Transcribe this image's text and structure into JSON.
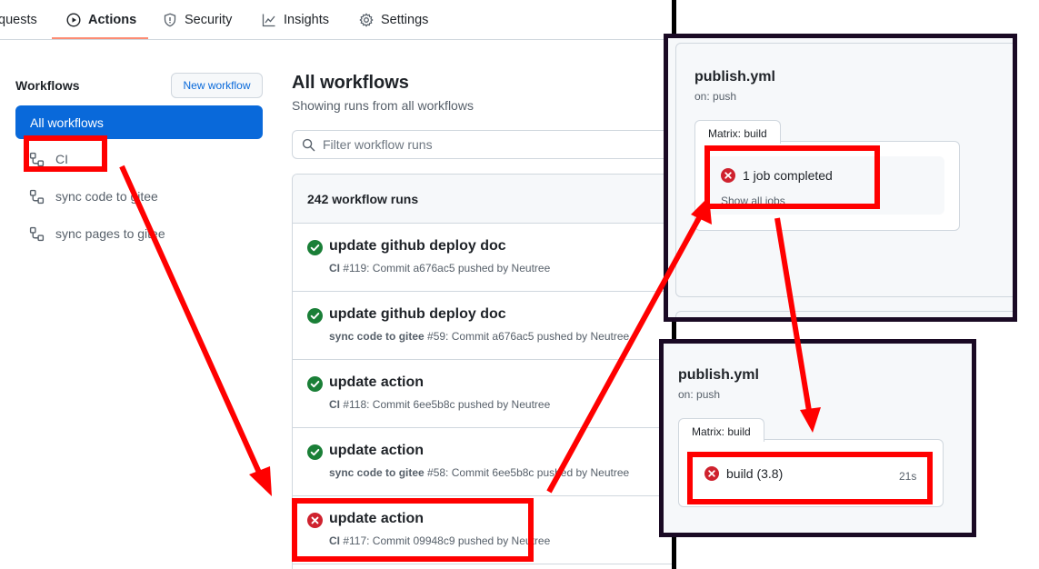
{
  "nav": {
    "tabs": [
      {
        "label": "quests",
        "icon": "pull-request-icon"
      },
      {
        "label": "Actions",
        "icon": "play-icon"
      },
      {
        "label": "Security",
        "icon": "shield-icon"
      },
      {
        "label": "Insights",
        "icon": "graph-icon"
      },
      {
        "label": "Settings",
        "icon": "gear-icon"
      }
    ],
    "active": "Actions"
  },
  "sidebar": {
    "heading": "Workflows",
    "new_workflow": "New workflow",
    "all_workflows": "All workflows",
    "items": [
      {
        "label": "CI",
        "icon": "workflow-icon"
      },
      {
        "label": "sync code to gitee",
        "icon": "workflow-icon"
      },
      {
        "label": "sync pages to gitee",
        "icon": "workflow-icon"
      }
    ]
  },
  "main": {
    "title": "All workflows",
    "subtitle": "Showing runs from all workflows",
    "filter_placeholder": "Filter workflow runs",
    "runs_count": "242 workflow runs",
    "runs": [
      {
        "title": "update github deploy doc",
        "workflow": "CI",
        "detail": " #119: Commit a676ac5 pushed by Neutree",
        "status": "success"
      },
      {
        "title": "update github deploy doc",
        "workflow": "sync code to gitee",
        "detail": " #59: Commit a676ac5 pushed by Neutree",
        "status": "success"
      },
      {
        "title": "update action",
        "workflow": "CI",
        "detail": " #118: Commit 6ee5b8c pushed by Neutree",
        "status": "success"
      },
      {
        "title": "update action",
        "workflow": "sync code to gitee",
        "detail": " #58: Commit 6ee5b8c pushed by Neutree",
        "status": "success"
      },
      {
        "title": "update action",
        "workflow": "CI",
        "detail": " #117: Commit 09948c9 pushed by Neutree",
        "status": "failure"
      }
    ]
  },
  "panel_top": {
    "title": "publish.yml",
    "subtitle": "on: push",
    "matrix_label": "Matrix: build",
    "job_summary": "1 job completed",
    "show_all": "Show all jobs"
  },
  "panel_bottom": {
    "title": "publish.yml",
    "subtitle": "on: push",
    "matrix_label": "Matrix: build",
    "job_name": "build (3.8)",
    "job_duration": "21s"
  },
  "colors": {
    "accent": "#0969da",
    "success": "#1a7f37",
    "failure": "#cf222e",
    "annotation": "#ff0000",
    "tab_underline": "#fd8c73"
  }
}
